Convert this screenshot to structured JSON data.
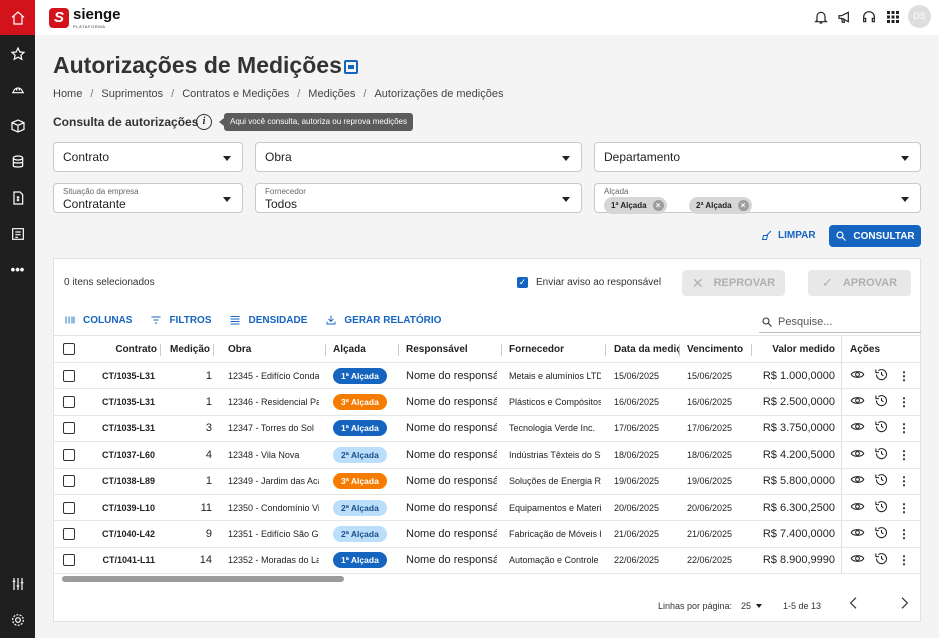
{
  "brand": {
    "name": "sienge",
    "sub": "PLATAFORMA",
    "mark": "S"
  },
  "user": {
    "initials": "DS"
  },
  "page": {
    "title": "Autorizações de Medições",
    "breadcrumb": [
      "Home",
      "Suprimentos",
      "Contratos e Medições",
      "Medições",
      "Autorizações de medições"
    ],
    "section_title": "Consulta de autorizações",
    "tooltip": "Aqui você consulta, autoriza ou reprova medições"
  },
  "filters": {
    "contrato": "Contrato",
    "obra": "Obra",
    "departamento": "Departamento",
    "situacao": {
      "label": "Situação da empresa",
      "value": "Contratante"
    },
    "fornecedor": {
      "label": "Fornecedor",
      "value": "Todos"
    },
    "alcada": {
      "label": "Alçada",
      "chips": [
        "1ª Alçada",
        "2ª Alçada"
      ]
    },
    "limpar": "LIMPAR",
    "consultar": "CONSULTAR"
  },
  "table_actions": {
    "selected": "0 itens selecionados",
    "notify": "Enviar aviso ao responsável",
    "reprovar": "REPROVAR",
    "aprovar": "APROVAR",
    "colunas": "COLUNAS",
    "filtros": "FILTROS",
    "densidade": "DENSIDADE",
    "relatorio": "GERAR RELATÓRIO",
    "search_placeholder": "Pesquise..."
  },
  "columns": [
    "Contrato",
    "Medição",
    "Obra",
    "Alçada",
    "Responsável",
    "Fornecedor",
    "Data da medição",
    "Vencimento",
    "Valor medido",
    "Ações"
  ],
  "rows": [
    {
      "contrato": "CT/1035-L31",
      "medicao": "1",
      "obra": "12345 - Edifício Condado",
      "alcada": "1ª Alçada",
      "lvl": 1,
      "responsavel": "Nome do responsável",
      "fornecedor": "Metais e alumínios LTDA",
      "data": "15/06/2025",
      "vencimento": "15/06/2025",
      "valor": "R$ 1.000,0000"
    },
    {
      "contrato": "CT/1035-L31",
      "medicao": "1",
      "obra": "12346 - Residencial Parque",
      "alcada": "3ª Alçada",
      "lvl": 3,
      "responsavel": "Nome do responsável",
      "fornecedor": "Plásticos e Compósitos",
      "data": "16/06/2025",
      "vencimento": "16/06/2025",
      "valor": "R$ 2.500,0000"
    },
    {
      "contrato": "CT/1035-L31",
      "medicao": "3",
      "obra": "12347 - Torres do Sol",
      "alcada": "1ª Alçada",
      "lvl": 1,
      "responsavel": "Nome do responsável",
      "fornecedor": "Tecnologia Verde Inc.",
      "data": "17/06/2025",
      "vencimento": "17/06/2025",
      "valor": "R$ 3.750,0000"
    },
    {
      "contrato": "CT/1037-L60",
      "medicao": "4",
      "obra": "12348 - Vila Nova",
      "alcada": "2ª Alçada",
      "lvl": 2,
      "responsavel": "Nome do responsável",
      "fornecedor": "Indústrias Têxteis do Sul",
      "data": "18/06/2025",
      "vencimento": "18/06/2025",
      "valor": "R$ 4.200,5000"
    },
    {
      "contrato": "CT/1038-L89",
      "medicao": "1",
      "obra": "12349 - Jardim das Acácias",
      "alcada": "3ª Alçada",
      "lvl": 3,
      "responsavel": "Nome do responsável",
      "fornecedor": "Soluções de Energia Renovável",
      "data": "19/06/2025",
      "vencimento": "19/06/2025",
      "valor": "R$ 5.800,0000"
    },
    {
      "contrato": "CT/1039-L10",
      "medicao": "11",
      "obra": "12350 - Condomínio Vista",
      "alcada": "2ª Alçada",
      "lvl": 2,
      "responsavel": "Nome do responsável",
      "fornecedor": "Equipamentos e Materiais",
      "data": "20/06/2025",
      "vencimento": "20/06/2025",
      "valor": "R$ 6.300,2500"
    },
    {
      "contrato": "CT/1040-L42",
      "medicao": "9",
      "obra": "12351 - Edifício São Gabriel",
      "alcada": "2ª Alçada",
      "lvl": 2,
      "responsavel": "Nome do responsável",
      "fornecedor": "Fabricação de Móveis Finos",
      "data": "21/06/2025",
      "vencimento": "21/06/2025",
      "valor": "R$ 7.400,0000"
    },
    {
      "contrato": "CT/1041-L11",
      "medicao": "14",
      "obra": "12352 - Moradas do Lago",
      "alcada": "1ª Alçada",
      "lvl": 1,
      "responsavel": "Nome do responsável",
      "fornecedor": "Automação e Controle",
      "data": "22/06/2025",
      "vencimento": "22/06/2025",
      "valor": "R$ 8.900,9990"
    }
  ],
  "pagination": {
    "label": "Linhas por página:",
    "per_page": "25",
    "range": "1-5 de 13"
  },
  "colors": {
    "brand_red": "#d3131b",
    "primary": "#1565c0",
    "alcada1": "#1565c0",
    "alcada2": "#bbdefb",
    "alcada3": "#f57c00"
  }
}
